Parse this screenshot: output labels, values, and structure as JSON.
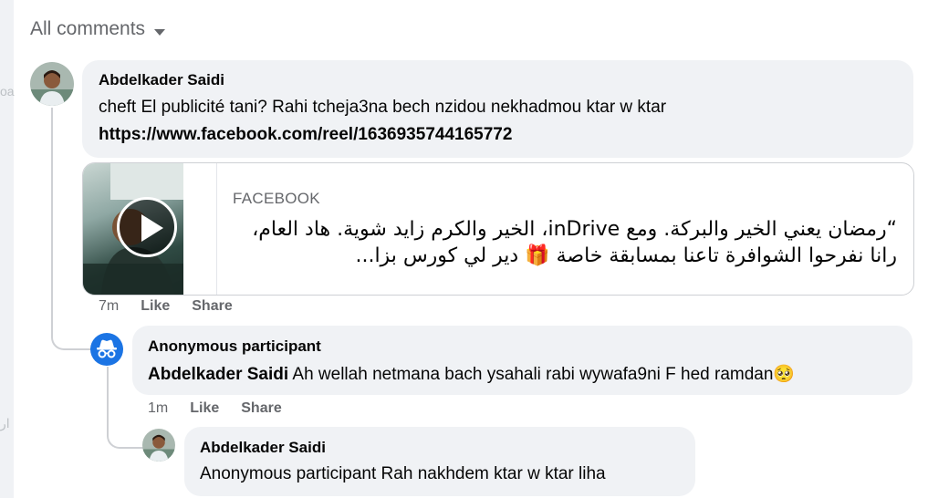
{
  "filter": {
    "label": "All comments"
  },
  "sidebar_fragments": {
    "top": "oa",
    "bottom": "ار"
  },
  "comments": [
    {
      "author": "Abdelkader Saidi",
      "text": "cheft El publicité tani? Rahi tcheja3na bech nzidou nekhadmou ktar w ktar",
      "link": "https://www.facebook.com/reel/1636935744165772",
      "preview": {
        "source": "FACEBOOK",
        "description": "“رمضان يعني الخير والبركة. ومع inDrive، الخير والكرم زايد شوية. هاد العام، رانا نفرحوا الشوافرة تاعنا بمسابقة خاصة 🎁 دير لي كورس بزا..."
      },
      "time": "7m",
      "like": "Like",
      "share": "Share"
    },
    {
      "author": "Anonymous participant",
      "mention": "Abdelkader Saidi",
      "text": " Ah wellah netmana bach ysahali rabi wywafa9ni F hed ramdan🥺",
      "time": "1m",
      "like": "Like",
      "share": "Share"
    },
    {
      "author": "Abdelkader Saidi",
      "text": "Anonymous participant Rah nakhdem ktar w ktar liha"
    }
  ],
  "colors": {
    "bubble": "#f0f2f5",
    "meta": "#65676b",
    "anon_avatar": "#1b74e4"
  }
}
